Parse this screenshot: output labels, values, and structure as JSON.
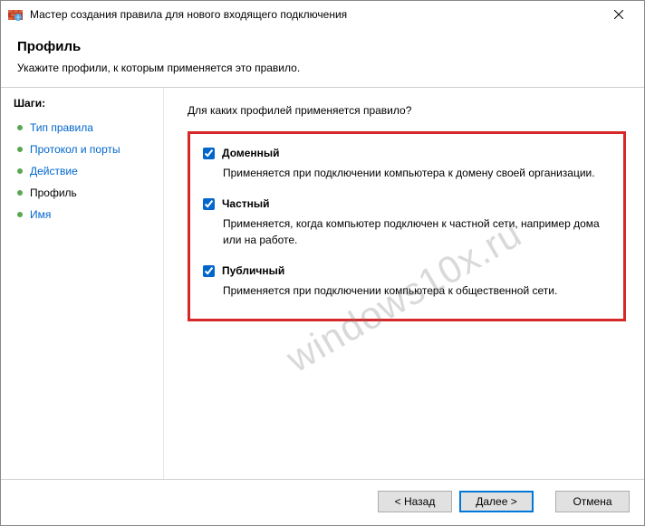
{
  "window": {
    "title": "Мастер создания правила для нового входящего подключения"
  },
  "header": {
    "title": "Профиль",
    "subtitle": "Укажите профили, к которым применяется это правило."
  },
  "sidebar": {
    "heading": "Шаги:",
    "items": [
      {
        "label": "Тип правила",
        "link": true
      },
      {
        "label": "Протокол и порты",
        "link": true
      },
      {
        "label": "Действие",
        "link": true
      },
      {
        "label": "Профиль",
        "link": false
      },
      {
        "label": "Имя",
        "link": true
      }
    ]
  },
  "main": {
    "question": "Для каких профилей применяется правило?",
    "options": [
      {
        "label": "Доменный",
        "desc": "Применяется при подключении компьютера к домену своей организации.",
        "checked": true
      },
      {
        "label": "Частный",
        "desc": "Применяется, когда компьютер подключен к частной сети, например дома или на работе.",
        "checked": true
      },
      {
        "label": "Публичный",
        "desc": "Применяется при подключении компьютера к общественной сети.",
        "checked": true
      }
    ]
  },
  "footer": {
    "back": "< Назад",
    "next": "Далее >",
    "cancel": "Отмена"
  },
  "watermark": "windows10x.ru"
}
